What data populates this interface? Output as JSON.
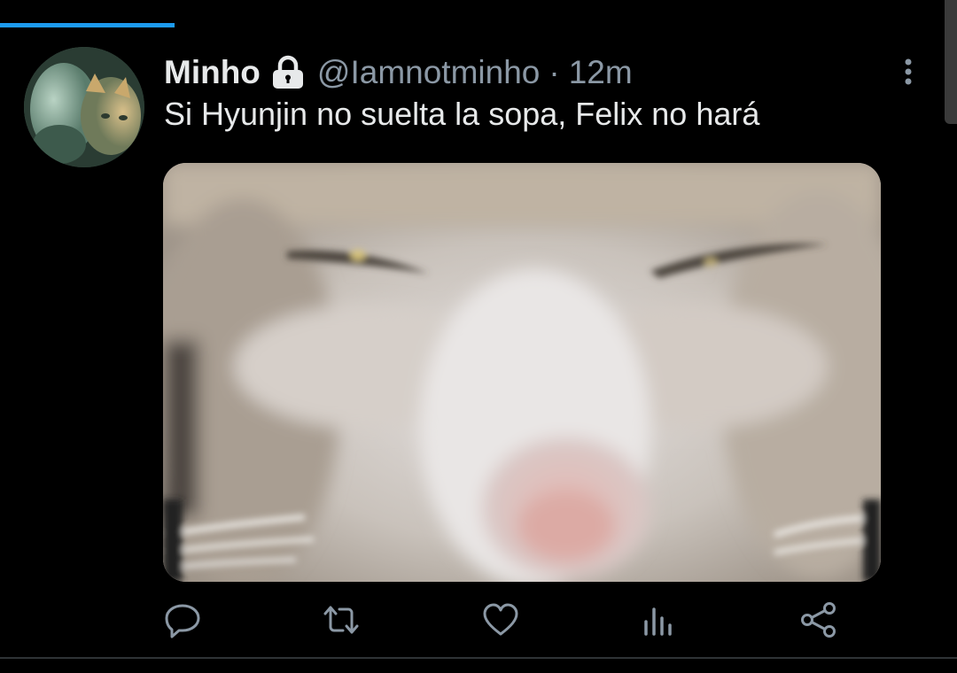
{
  "tweet": {
    "display_name": "Minho",
    "handle": "@Iamnotminho",
    "separator": "·",
    "time": "12m",
    "text": "Si Hyunjin no suelta la sopa, Felix no hará"
  },
  "icons": {
    "protected": "lock-icon",
    "more": "more-vertical-icon",
    "actions": [
      "reply-icon",
      "retweet-icon",
      "like-icon",
      "analytics-icon",
      "share-icon"
    ]
  },
  "colors": {
    "background": "#000000",
    "text": "#e7e9ea",
    "secondary": "#8b98a5",
    "accent": "#1d9bf0"
  }
}
